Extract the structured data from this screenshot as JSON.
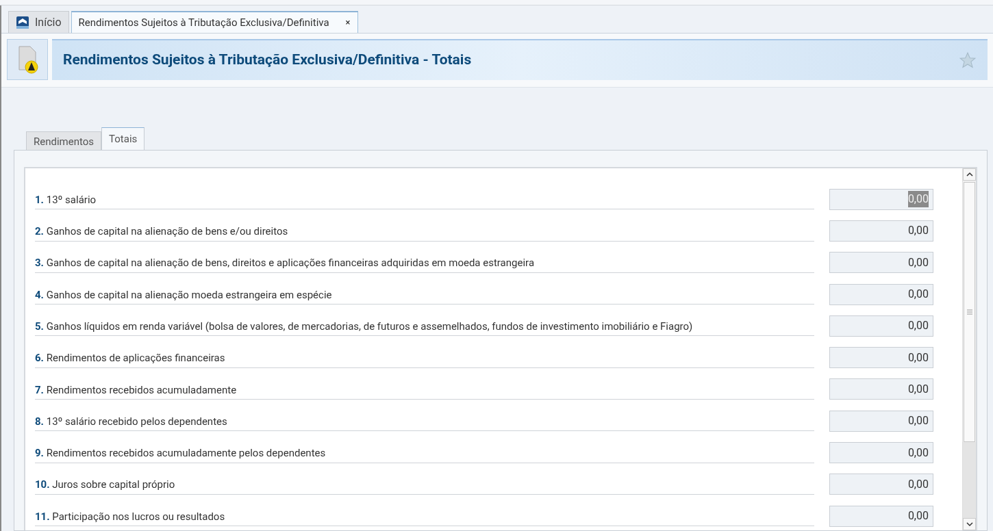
{
  "doc_tabs": [
    {
      "label": "Início",
      "selected": false
    },
    {
      "label": "Rendimentos Sujeitos à Tributação Exclusiva/Definitiva",
      "selected": true,
      "close": "×"
    }
  ],
  "header": {
    "title": "Rendimentos Sujeitos à Tributação Exclusiva/Definitiva - Totais"
  },
  "tabs": [
    {
      "label": "Rendimentos",
      "selected": false
    },
    {
      "label": "Totais",
      "selected": true
    }
  ],
  "rows": [
    {
      "number": "1.",
      "label": "13º salário",
      "value": "0,00",
      "highlighted": true
    },
    {
      "number": "2.",
      "label": "Ganhos de capital na alienação de bens e/ou direitos",
      "value": "0,00",
      "highlighted": false
    },
    {
      "number": "3.",
      "label": "Ganhos de capital na alienação de bens, direitos e aplicações financeiras adquiridas em moeda estrangeira",
      "value": "0,00",
      "highlighted": false
    },
    {
      "number": "4.",
      "label": "Ganhos de capital na alienação moeda estrangeira em espécie",
      "value": "0,00",
      "highlighted": false
    },
    {
      "number": "5.",
      "label": "Ganhos líquidos em renda variável (bolsa de valores, de mercadorias, de futuros e assemelhados, fundos de investimento imobiliário e Fiagro)",
      "value": "0,00",
      "highlighted": false
    },
    {
      "number": "6.",
      "label": "Rendimentos de aplicações financeiras",
      "value": "0,00",
      "highlighted": false
    },
    {
      "number": "7.",
      "label": "Rendimentos recebidos acumuladamente",
      "value": "0,00",
      "highlighted": false
    },
    {
      "number": "8.",
      "label": "13º salário recebido pelos dependentes",
      "value": "0,00",
      "highlighted": false
    },
    {
      "number": "9.",
      "label": "Rendimentos recebidos acumuladamente pelos dependentes",
      "value": "0,00",
      "highlighted": false
    },
    {
      "number": "10.",
      "label": "Juros sobre capital próprio",
      "value": "0,00",
      "highlighted": false
    },
    {
      "number": "11.",
      "label": "Participação nos lucros ou resultados",
      "value": "0,00",
      "highlighted": false
    }
  ]
}
